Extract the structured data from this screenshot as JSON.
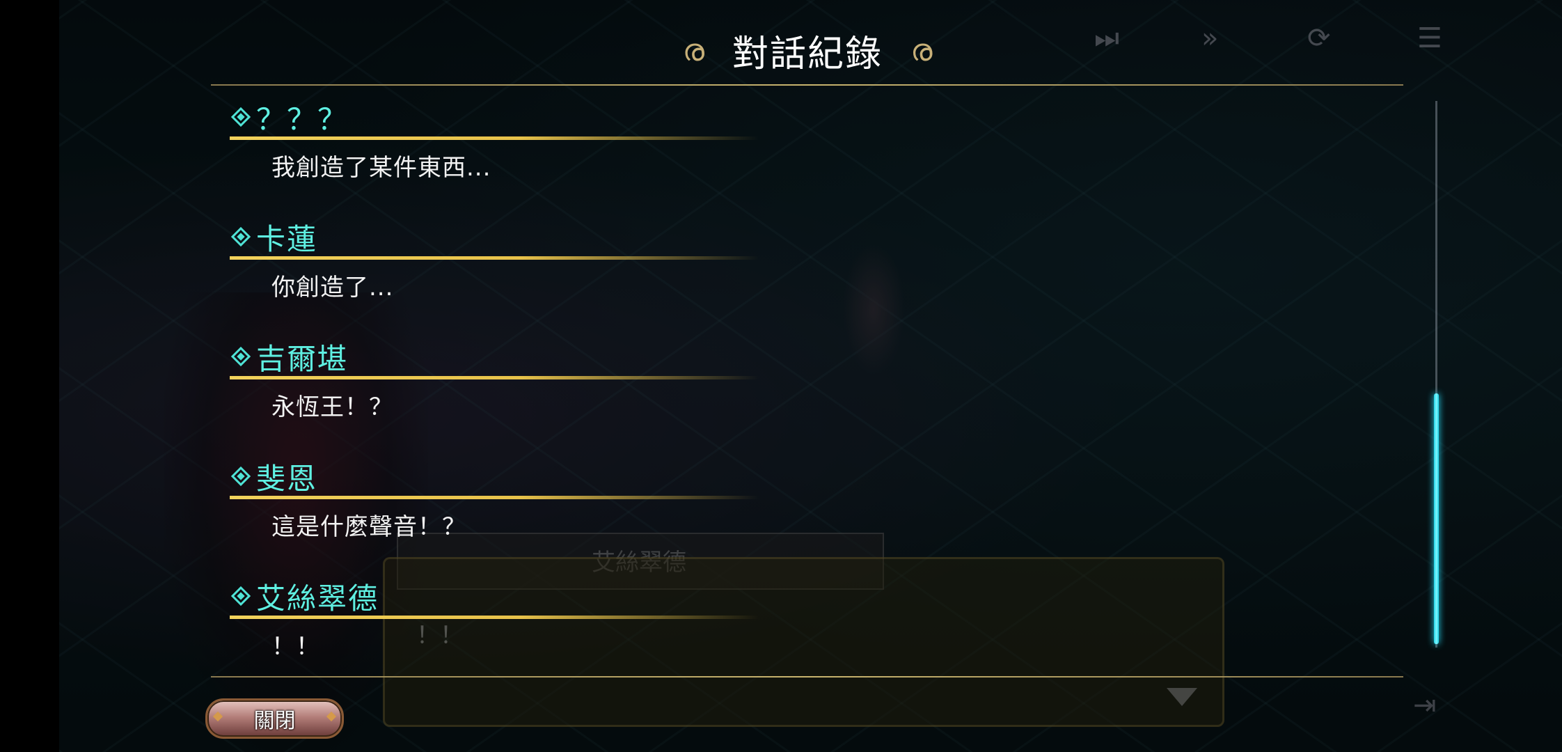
{
  "log": {
    "title": "對話紀錄",
    "entries": [
      {
        "speaker": "？？？",
        "text": "我創造了某件東西..."
      },
      {
        "speaker": "卡蓮",
        "text": "你創造了..."
      },
      {
        "speaker": "吉爾堪",
        "text": "永恆王！？"
      },
      {
        "speaker": "斐恩",
        "text": "這是什麼聲音！？"
      },
      {
        "speaker": "艾絲翠德",
        "text": "！！"
      }
    ],
    "close_label": "關閉"
  },
  "background_dialog": {
    "speaker": "艾絲翠德",
    "text": "！！"
  },
  "top_icons": [
    "fast-forward-end-icon",
    "fast-forward-icon",
    "auto-play-icon",
    "log-icon"
  ],
  "colors": {
    "speaker": "#5ff0e2",
    "underline": "#f2d25c",
    "rule": "#c8b078",
    "scroll_thumb": "#1fd3e6"
  },
  "scroll_position_fraction": 0.55
}
